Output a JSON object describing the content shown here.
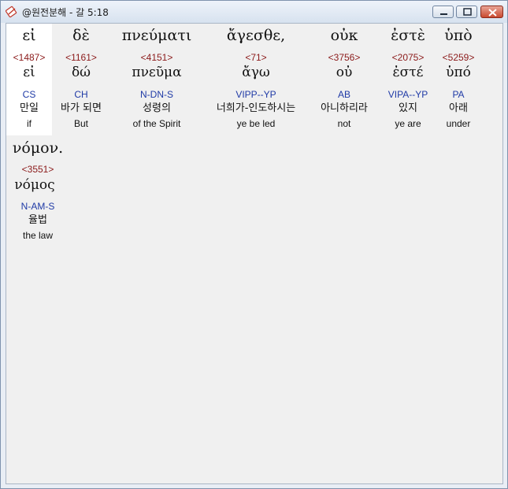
{
  "window": {
    "title": "@원전분해 - 갈 5:18"
  },
  "words": [
    {
      "greek": "εἰ",
      "strong": "<1487>",
      "lemma": "εἰ",
      "parse": "CS",
      "korean": "만일",
      "english": "if"
    },
    {
      "greek": "δὲ",
      "strong": "<1161>",
      "lemma": "δώ",
      "parse": "CH",
      "korean": "바가 되면",
      "english": "But"
    },
    {
      "greek": "πνεύματι",
      "strong": "<4151>",
      "lemma": "πνεῦμα",
      "parse": "N-DN-S",
      "korean": "성령의",
      "english": "of the Spirit"
    },
    {
      "greek": "ἄγεσθε,",
      "strong": "<71>",
      "lemma": "ἄγω",
      "parse": "VIPP--YP",
      "korean": "너희가-인도하시는",
      "english": "ye be led"
    },
    {
      "greek": "οὐκ",
      "strong": "<3756>",
      "lemma": "οὐ",
      "parse": "AB",
      "korean": "아니하리라",
      "english": "not"
    },
    {
      "greek": "ἐστὲ",
      "strong": "<2075>",
      "lemma": "ἐστέ",
      "parse": "VIPA--YP",
      "korean": "있지",
      "english": "ye are"
    },
    {
      "greek": "ὑπὸ",
      "strong": "<5259>",
      "lemma": "ὑπό",
      "parse": "PA",
      "korean": "아래",
      "english": "under"
    },
    {
      "greek": "νόμον.",
      "strong": "<3551>",
      "lemma": "νόμος",
      "parse": "N-AM-S",
      "korean": "율법",
      "english": "the law"
    }
  ]
}
